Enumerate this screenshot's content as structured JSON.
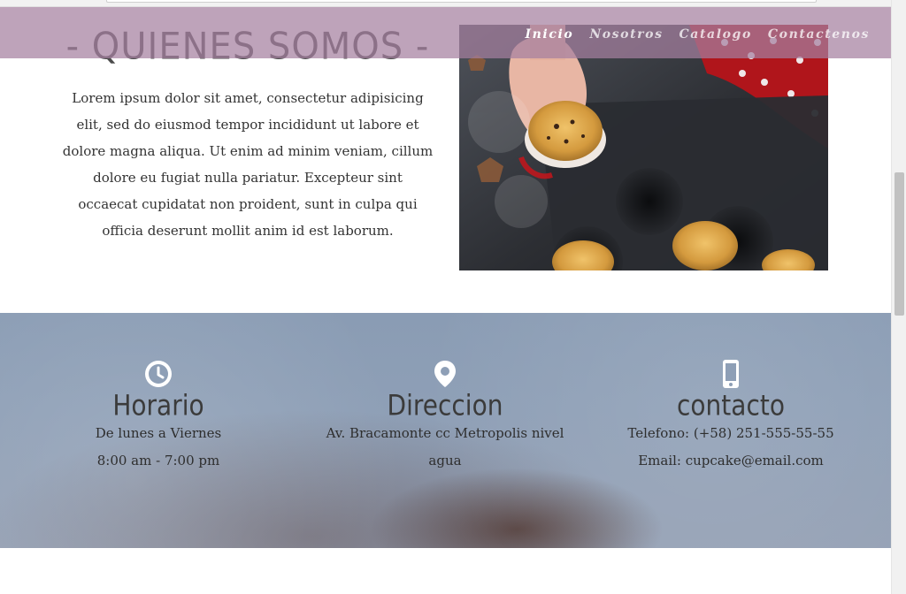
{
  "nav": {
    "links": [
      "Inicio",
      "Nosotros",
      "Catalogo",
      "Contactenos"
    ]
  },
  "about": {
    "title": "- QUIENES SOMOS -",
    "text": "Lorem ipsum dolor sit amet, consectetur adipisicing elit, sed do eiusmod tempor incididunt ut labore et dolore magna aliqua. Ut enim ad minim veniam, cillum dolore eu fugiat nulla pariatur. Excepteur sint occaecat cupidatat non proident, sunt in culpa qui officia deserunt mollit anim id est laborum."
  },
  "info": {
    "horario": {
      "icon": "clock-icon",
      "title": "Horario",
      "lines": [
        "De lunes a Viernes",
        "8:00 am - 7:00 pm"
      ]
    },
    "direccion": {
      "icon": "map-pin-icon",
      "title": "Direccion",
      "lines": [
        "Av. Bracamonte cc Metropolis nivel agua"
      ]
    },
    "contacto": {
      "icon": "phone-icon",
      "title": "contacto",
      "lines": [
        "Telefono: (+58) 251-555-55-55",
        "Email: cupcake@email.com"
      ]
    }
  },
  "colors": {
    "navbar": "#a580a0",
    "info_band": "#8e9fb6",
    "text": "#333333"
  }
}
